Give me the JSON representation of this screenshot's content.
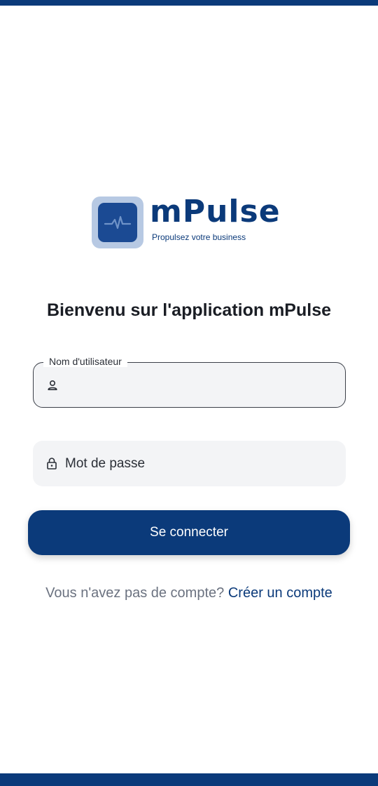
{
  "brand": {
    "name": "mPulse",
    "tagline": "Propulsez votre business",
    "primary_color": "#0b3a7a",
    "tile_light": "#b7c9e3",
    "tile_dark": "#1b4a93"
  },
  "welcome_title": "Bienvenu sur l'application mPulse",
  "username_field": {
    "label": "Nom d'utilisateur",
    "value": "",
    "icon": "person-icon"
  },
  "password_field": {
    "placeholder": "Mot de passe",
    "icon": "lock-icon"
  },
  "login_button": {
    "label": "Se connecter"
  },
  "signup": {
    "prompt": "Vous n'avez pas de compte?",
    "link": "Créer un compte"
  }
}
